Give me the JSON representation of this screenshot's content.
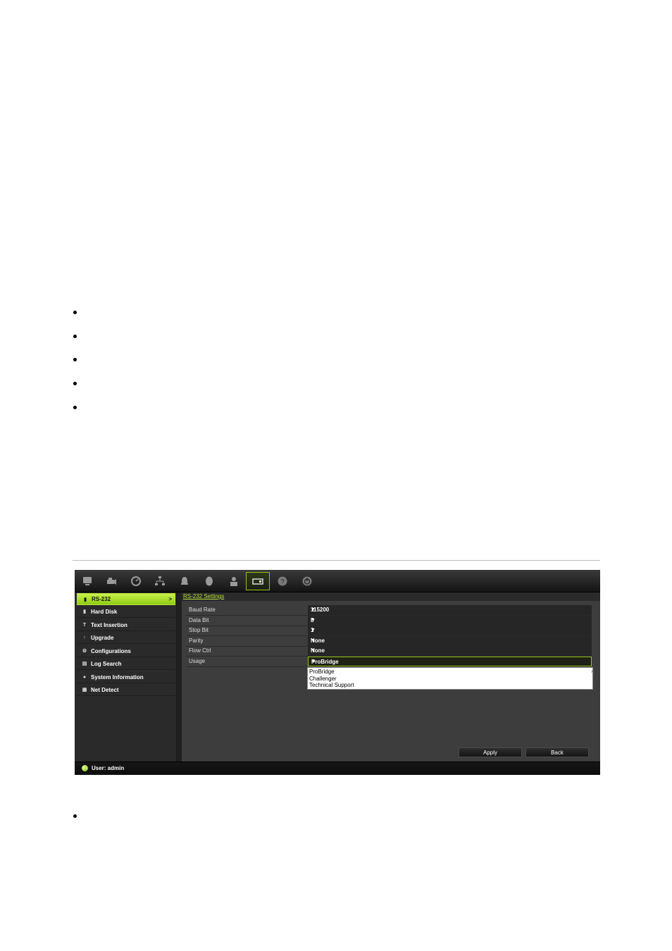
{
  "toolbar": {
    "icons": [
      "monitor-icon",
      "camera-icon",
      "clock-icon",
      "network-icon",
      "alarm-icon",
      "mouse-icon",
      "user-lock-icon",
      "device-management-icon",
      "help-icon",
      "power-icon"
    ],
    "active_index": 7
  },
  "sidebar": {
    "items": [
      {
        "label": "RS-232",
        "icon": "serial-port-icon"
      },
      {
        "label": "Hard Disk",
        "icon": "disk-icon"
      },
      {
        "label": "Text Insertion",
        "icon": "text-insertion-icon"
      },
      {
        "label": "Upgrade",
        "icon": "upgrade-icon"
      },
      {
        "label": "Configurations",
        "icon": "configurations-icon"
      },
      {
        "label": "Log Search",
        "icon": "log-search-icon"
      },
      {
        "label": "System Information",
        "icon": "info-icon"
      },
      {
        "label": "Net Detect",
        "icon": "net-detect-icon"
      }
    ],
    "active_arrow": ">"
  },
  "main": {
    "tab": "RS-232 Settings",
    "fields": [
      {
        "label": "Baud Rate",
        "value": "115200"
      },
      {
        "label": "Data Bit",
        "value": "8"
      },
      {
        "label": "Stop Bit",
        "value": "1"
      },
      {
        "label": "Parity",
        "value": "None"
      },
      {
        "label": "Flow Ctrl",
        "value": "None"
      },
      {
        "label": "Usage",
        "value": "ProBridge"
      }
    ],
    "usage_options": [
      "ProBridge",
      "Challenger",
      "Technical Support"
    ],
    "apply_label": "Apply",
    "back_label": "Back"
  },
  "status": {
    "user": "User: admin"
  },
  "colors": {
    "accent": "#9ac21c",
    "panel": "#3d3d3d",
    "sidebar": "#2a2a2a"
  }
}
